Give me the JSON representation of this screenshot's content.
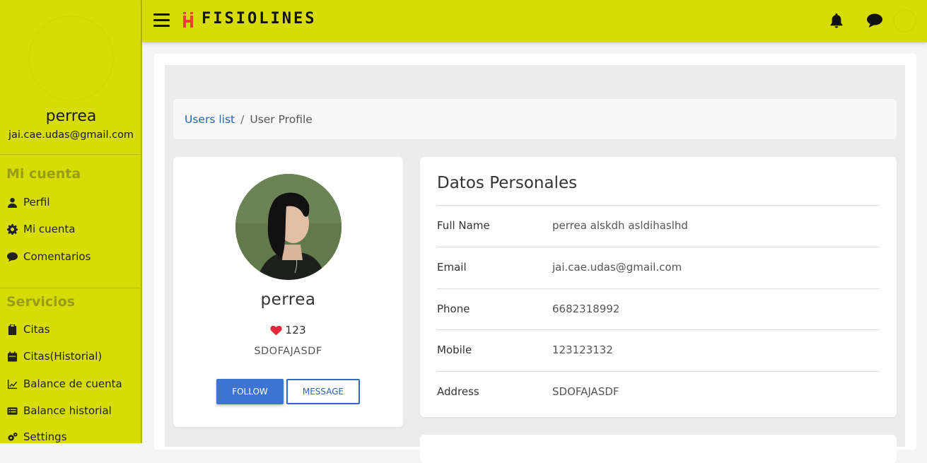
{
  "app": {
    "brand": "FISIOLINES",
    "brand_color": "#d8dc06",
    "logo_color": "#e8412c"
  },
  "sidebar": {
    "user_name": "perrea",
    "user_email": "jai.cae.udas@gmail.com",
    "sections": [
      {
        "title": "Mi cuenta",
        "items": [
          {
            "label": "Perfil",
            "icon": "user-icon"
          },
          {
            "label": "Mi cuenta",
            "icon": "gear-icon"
          },
          {
            "label": "Comentarios",
            "icon": "comment-icon"
          }
        ]
      },
      {
        "title": "Servicios",
        "items": [
          {
            "label": "Citas",
            "icon": "clipboard-icon"
          },
          {
            "label": "Citas(Historial)",
            "icon": "calendar-icon"
          },
          {
            "label": "Balance de cuenta",
            "icon": "line-chart-icon"
          },
          {
            "label": "Balance historial",
            "icon": "card-list-icon"
          },
          {
            "label": "Settings",
            "icon": "gears-icon"
          }
        ]
      }
    ]
  },
  "topbar": {
    "icons": [
      "bell-icon",
      "chat-icon"
    ]
  },
  "breadcrumb": {
    "link": "Users list",
    "separator": "/",
    "current": "User Profile"
  },
  "profile": {
    "name": "perrea",
    "likes": "123",
    "address": "SDOFAJASDF",
    "follow_label": "FOLLOW",
    "message_label": "MESSAGE"
  },
  "details": {
    "title": "Datos Personales",
    "rows": [
      {
        "label": "Full Name",
        "value": "perrea alskdh asldihaslhd"
      },
      {
        "label": "Email",
        "value": "jai.cae.udas@gmail.com"
      },
      {
        "label": "Phone",
        "value": "6682318992"
      },
      {
        "label": "Mobile",
        "value": "123123132"
      },
      {
        "label": "Address",
        "value": "SDOFAJASDF"
      }
    ]
  }
}
